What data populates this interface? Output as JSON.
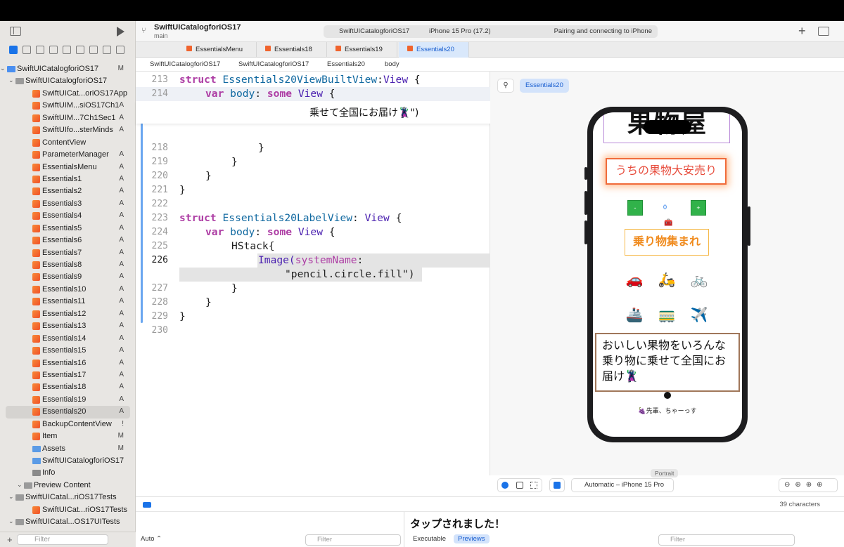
{
  "window": {
    "project_title": "SwiftUICatalogforiOS17",
    "branch": "main",
    "scheme": "SwiftUICatalogforiOS17",
    "device": "iPhone 15 Pro (17.2)",
    "status": "Pairing and connecting to iPhone",
    "add_label": "+"
  },
  "navigator": {
    "items": [
      {
        "label": "SwiftUICatalogforiOS17",
        "badge": "M",
        "indent": 10,
        "kind": "project"
      },
      {
        "label": "SwiftUICatalogforiOS17",
        "badge": "",
        "indent": 22,
        "kind": "folder"
      },
      {
        "label": "SwiftUICat...oriOS17App",
        "badge": "",
        "indent": 46,
        "kind": "swift"
      },
      {
        "label": "SwiftUIM...siOS17Ch1",
        "badge": "A",
        "indent": 46,
        "kind": "swift"
      },
      {
        "label": "SwiftUIM...7Ch1Sec1",
        "badge": "A",
        "indent": 46,
        "kind": "swift"
      },
      {
        "label": "SwiftUIfo...sterMinds",
        "badge": "A",
        "indent": 46,
        "kind": "swift"
      },
      {
        "label": "ContentView",
        "badge": "",
        "indent": 46,
        "kind": "swift"
      },
      {
        "label": "ParameterManager",
        "badge": "A",
        "indent": 46,
        "kind": "swift"
      },
      {
        "label": "EssentialsMenu",
        "badge": "A",
        "indent": 46,
        "kind": "swift"
      },
      {
        "label": "Essentials1",
        "badge": "A",
        "indent": 46,
        "kind": "swift"
      },
      {
        "label": "Essentials2",
        "badge": "A",
        "indent": 46,
        "kind": "swift"
      },
      {
        "label": "Essentials3",
        "badge": "A",
        "indent": 46,
        "kind": "swift"
      },
      {
        "label": "Essentials4",
        "badge": "A",
        "indent": 46,
        "kind": "swift"
      },
      {
        "label": "Essentials5",
        "badge": "A",
        "indent": 46,
        "kind": "swift"
      },
      {
        "label": "Essentials6",
        "badge": "A",
        "indent": 46,
        "kind": "swift"
      },
      {
        "label": "Essentials7",
        "badge": "A",
        "indent": 46,
        "kind": "swift"
      },
      {
        "label": "Essentials8",
        "badge": "A",
        "indent": 46,
        "kind": "swift"
      },
      {
        "label": "Essentials9",
        "badge": "A",
        "indent": 46,
        "kind": "swift"
      },
      {
        "label": "Essentials10",
        "badge": "A",
        "indent": 46,
        "kind": "swift"
      },
      {
        "label": "Essentials11",
        "badge": "A",
        "indent": 46,
        "kind": "swift"
      },
      {
        "label": "Essentials12",
        "badge": "A",
        "indent": 46,
        "kind": "swift"
      },
      {
        "label": "Essentials13",
        "badge": "A",
        "indent": 46,
        "kind": "swift"
      },
      {
        "label": "Essentials14",
        "badge": "A",
        "indent": 46,
        "kind": "swift"
      },
      {
        "label": "Essentials15",
        "badge": "A",
        "indent": 46,
        "kind": "swift"
      },
      {
        "label": "Essentials16",
        "badge": "A",
        "indent": 46,
        "kind": "swift"
      },
      {
        "label": "Essentials17",
        "badge": "A",
        "indent": 46,
        "kind": "swift"
      },
      {
        "label": "Essentials18",
        "badge": "A",
        "indent": 46,
        "kind": "swift"
      },
      {
        "label": "Essentials19",
        "badge": "A",
        "indent": 46,
        "kind": "swift"
      },
      {
        "label": "Essentials20",
        "badge": "A",
        "indent": 46,
        "kind": "swift",
        "selected": true
      },
      {
        "label": "BackupContentView",
        "badge": "!",
        "indent": 46,
        "kind": "swift"
      },
      {
        "label": "Item",
        "badge": "M",
        "indent": 46,
        "kind": "swift"
      },
      {
        "label": "Assets",
        "badge": "M",
        "indent": 46,
        "kind": "asset"
      },
      {
        "label": "SwiftUICatalogforiOS17",
        "badge": "",
        "indent": 46,
        "kind": "asset"
      },
      {
        "label": "Info",
        "badge": "",
        "indent": 46,
        "kind": "plist"
      },
      {
        "label": "Preview Content",
        "badge": "",
        "indent": 34,
        "kind": "folder"
      },
      {
        "label": "SwiftUICatal...riOS17Tests",
        "badge": "",
        "indent": 22,
        "kind": "folder"
      },
      {
        "label": "SwiftUICat...riOS17Tests",
        "badge": "",
        "indent": 46,
        "kind": "swift"
      },
      {
        "label": "SwiftUICatal...OS17UITests",
        "badge": "",
        "indent": 22,
        "kind": "folder"
      }
    ],
    "filter_placeholder": "Filter"
  },
  "tabs": [
    "EssentialsMenu",
    "Essentials18",
    "Essentials19",
    "Essentials20"
  ],
  "breadcrumb": [
    "SwiftUICatalogforiOS17",
    "SwiftUICatalogforiOS17",
    "Essentials20",
    "body"
  ],
  "code": {
    "l213_num": "213",
    "l214_num": "214",
    "l218_num": "218",
    "l218": "}",
    "l219_num": "219",
    "l219": "}",
    "l220_num": "220",
    "l220": "}",
    "l221_num": "221",
    "l221": "}",
    "l222_num": "222",
    "l223_num": "223",
    "l224_num": "224",
    "l225_num": "225",
    "l225": "HStack{",
    "l226_num": "226",
    "l227_num": "227",
    "l227": "}",
    "l228_num": "228",
    "l228": "}",
    "l229_num": "229",
    "l229": "}",
    "l230_num": "230",
    "overlay_text": "乗せて全国にお届け🦹\")",
    "struct_kw": "struct",
    "var_kw": "var",
    "some_kw": "some",
    "body_name": "body",
    "view_type": "View",
    "builtview_name": "Essentials20ViewBuiltView",
    "labelview_name": "Essentials20LabelView",
    "image_fn": "Image(",
    "system_name": "systemName",
    "pencil_str": "\"pencil.circle.fill\")",
    "open_brace": "{",
    "colon": ":",
    "colon_sp": ": "
  },
  "canvas": {
    "preview_chip": "Essentials20",
    "pin_label": "⚲",
    "portrait": "Portrait",
    "device_select": "Automatic – iPhone 15 Pro",
    "zoom_icons": "⊖⊕⊕⊕"
  },
  "app": {
    "title": "果物屋",
    "sale": "うちの果物大安売り",
    "minus": "-",
    "count": "0",
    "plus": "+",
    "briefcase": "🧰",
    "vehicle_title": "乗り物集まれ",
    "vehicles": [
      "🚗",
      "🛵",
      "🚲",
      "🚢",
      "🚃",
      "✈️"
    ],
    "message": "おいしい果物をいろんな乗り物に乗せて全国にお届け🦹",
    "senpai": "🍇先輩、ちゃーっす"
  },
  "debug": {
    "chars": "39 characters",
    "console_output": "タップされました！",
    "auto_label": "Auto ⌃",
    "filter_placeholder": "Filter",
    "executable": "Executable",
    "previews": "Previews"
  }
}
